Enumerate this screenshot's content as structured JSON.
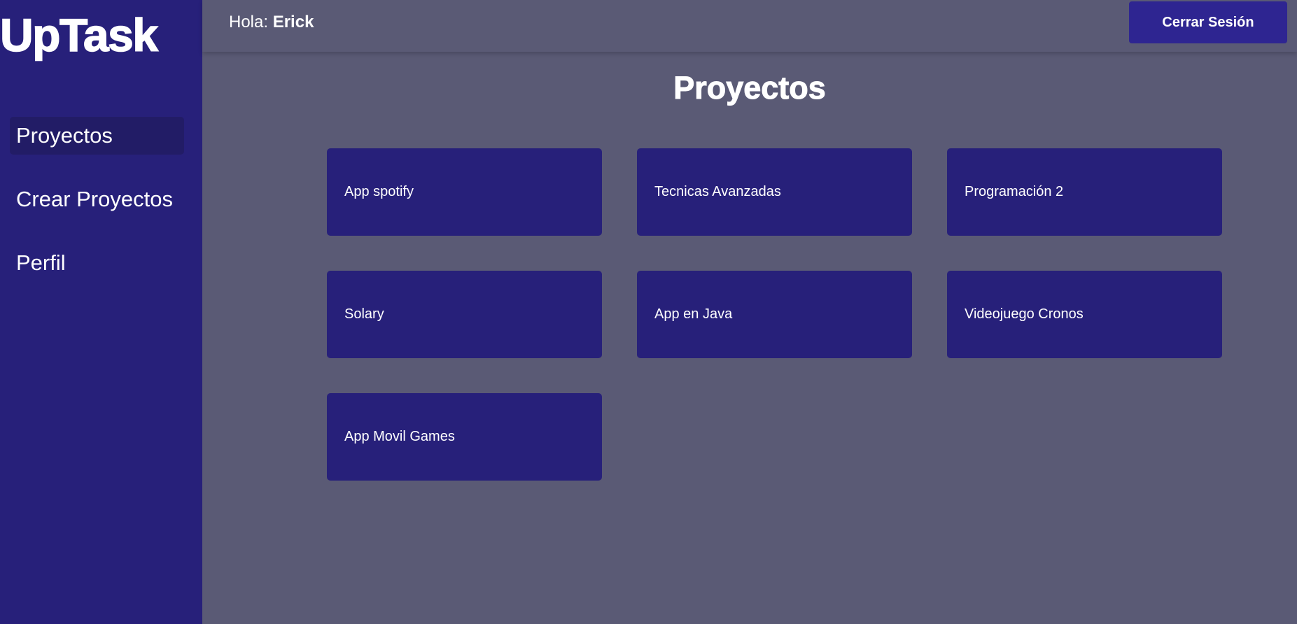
{
  "app": {
    "logo": "UpTask"
  },
  "sidebar": {
    "items": [
      {
        "label": "Proyectos",
        "active": true
      },
      {
        "label": "Crear Proyectos",
        "active": false
      },
      {
        "label": "Perfil",
        "active": false
      }
    ]
  },
  "header": {
    "greeting_prefix": "Hola:",
    "user_name": "Erick",
    "logout_label": "Cerrar Sesión"
  },
  "main": {
    "title": "Proyectos",
    "projects": [
      {
        "name": "App spotify"
      },
      {
        "name": "Tecnicas Avanzadas"
      },
      {
        "name": "Programación 2"
      },
      {
        "name": "Solary"
      },
      {
        "name": "App en Java"
      },
      {
        "name": "Videojuego Cronos"
      },
      {
        "name": "App Movil Games"
      }
    ]
  },
  "colors": {
    "sidebar_bg": "#27207a",
    "active_item_bg": "#221c66",
    "main_bg": "#5a5a75",
    "card_bg": "#27207a",
    "button_bg": "#2e2591"
  }
}
